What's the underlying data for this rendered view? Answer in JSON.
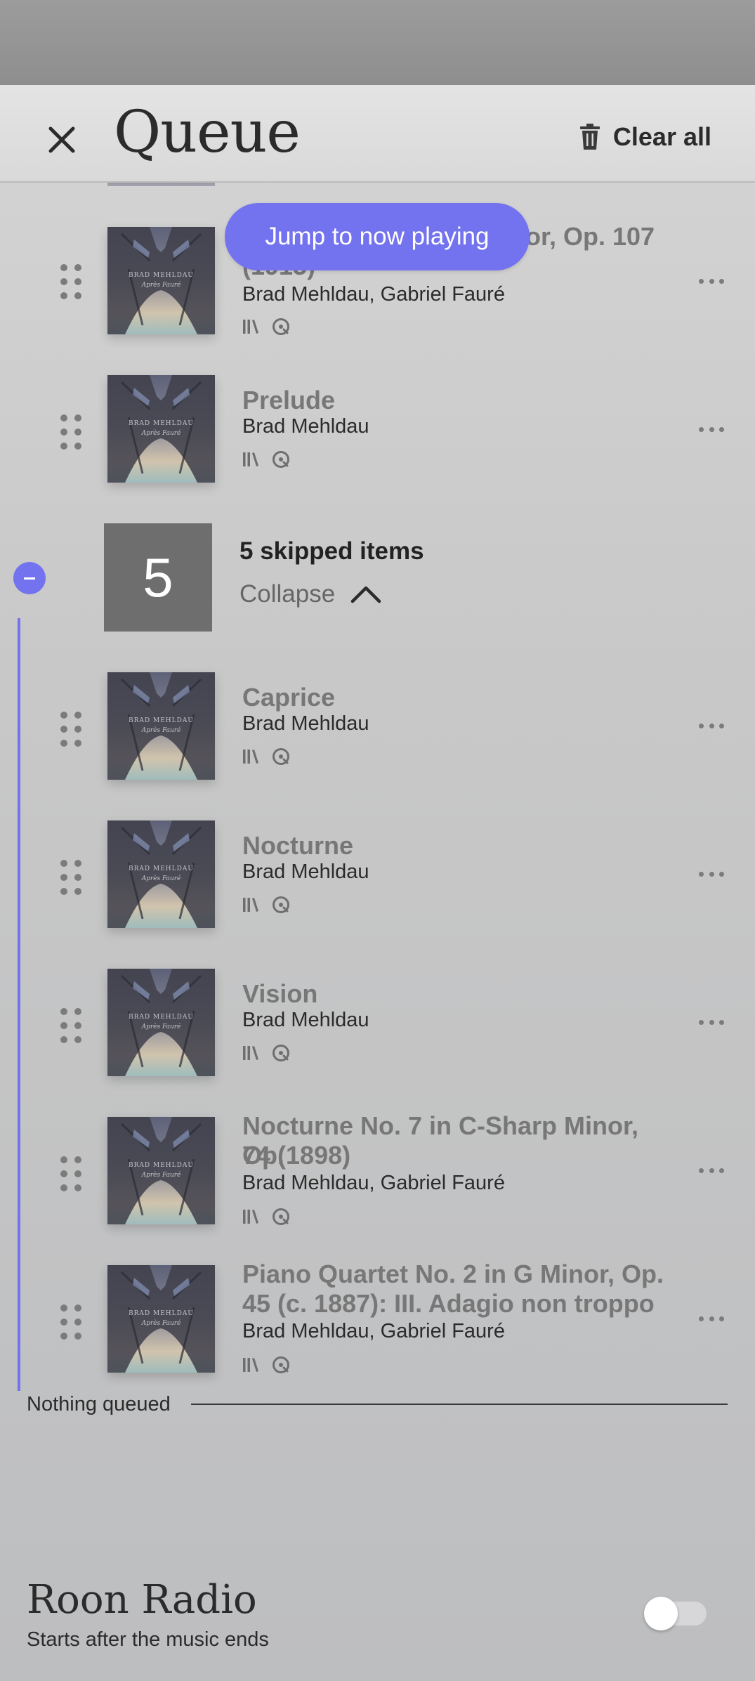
{
  "header": {
    "title": "Queue",
    "close_icon": "close-icon",
    "clear_all_label": "Clear all",
    "clear_all_icon": "trash-icon"
  },
  "jump_button": {
    "label": "Jump to now playing"
  },
  "album_cover": {
    "artist_line": "BRAD MEHLDAU",
    "album_line": "Après Fauré"
  },
  "tracks_top": [
    {
      "title": "…or, Op. 107 (1915)",
      "title_visible_line1": "or, Op. 107",
      "title_visible_line2": "(1915)",
      "artist": "Brad Mehldau, Gabriel Fauré"
    },
    {
      "title": "Prelude",
      "artist": "Brad Mehldau"
    }
  ],
  "skipped": {
    "count": "5",
    "label": "5 skipped items",
    "collapse_label": "Collapse"
  },
  "skipped_tracks": [
    {
      "title": "Caprice",
      "artist": "Brad Mehldau"
    },
    {
      "title": "Nocturne",
      "artist": "Brad Mehldau"
    },
    {
      "title": "Vision",
      "artist": "Brad Mehldau"
    },
    {
      "title_line1": "Nocturne No. 7 in C-Sharp Minor, Op.",
      "title_line2": "74 (1898)",
      "artist": "Brad Mehldau, Gabriel Fauré"
    },
    {
      "title_line1": "Piano Quartet No. 2 in G Minor, Op.",
      "title_line2": "45 (c. 1887): III. Adagio non troppo",
      "artist": "Brad Mehldau, Gabriel Fauré"
    }
  ],
  "nothing_queued": "Nothing queued",
  "radio": {
    "title": "Roon Radio",
    "subtitle": "Starts after the music ends",
    "enabled": false
  },
  "colors": {
    "accent": "#7473ef",
    "skipped_box": "#6e6e6e",
    "title_gray": "#777777"
  }
}
